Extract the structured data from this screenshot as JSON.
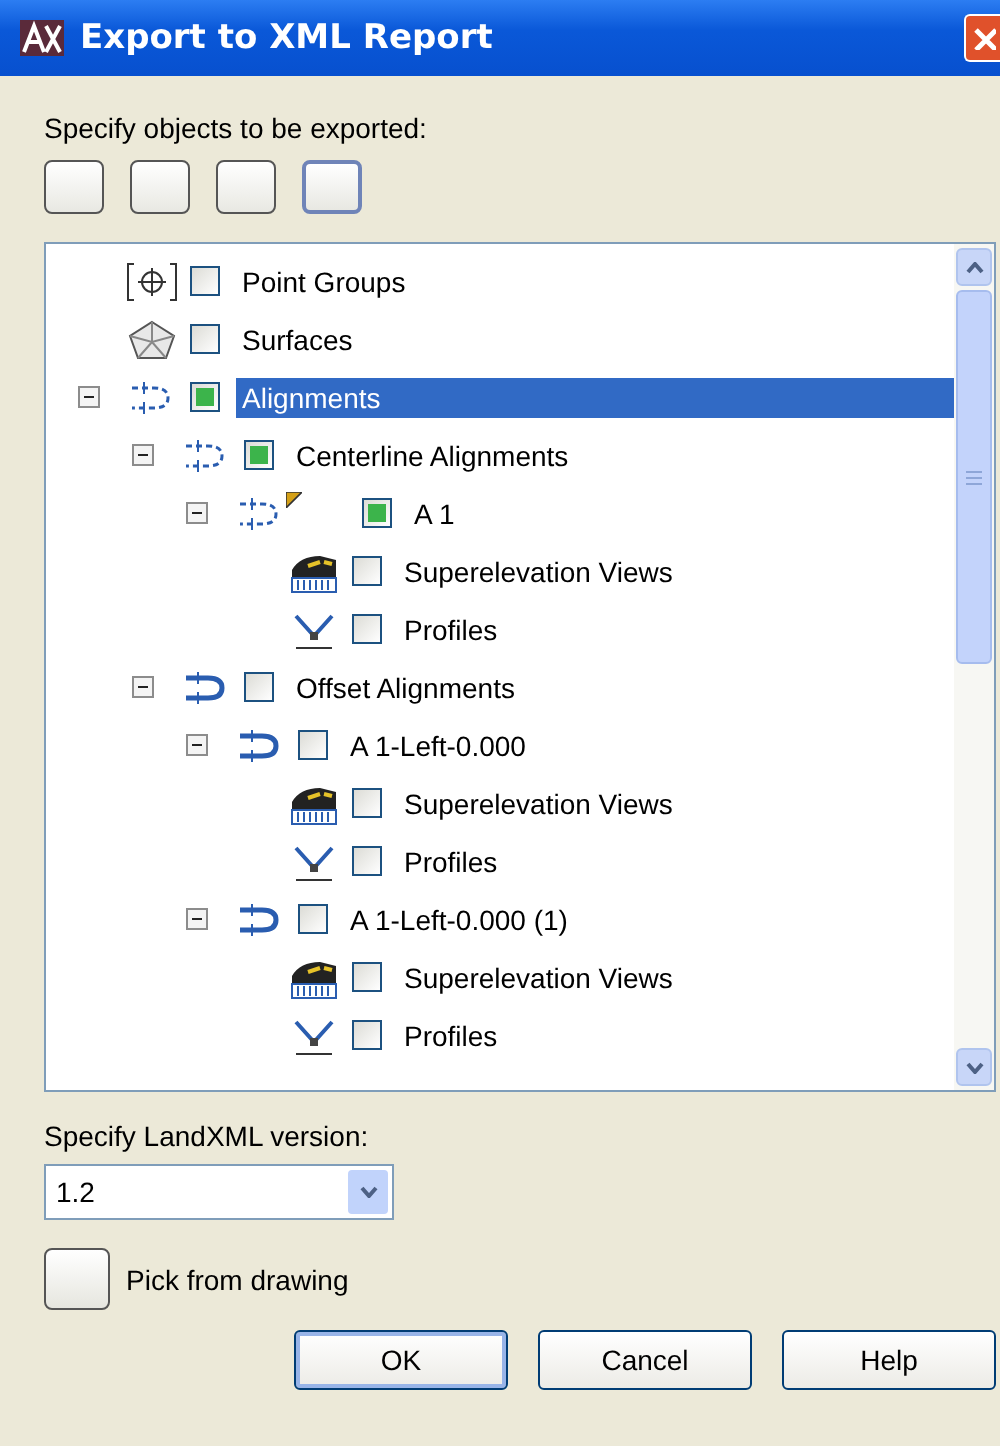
{
  "window": {
    "title": "Export to XML Report"
  },
  "objects_label": "Specify objects to be exported:",
  "toolbar_buttons": [
    {
      "selected": false
    },
    {
      "selected": false
    },
    {
      "selected": false
    },
    {
      "selected": true
    }
  ],
  "tree": [
    {
      "kind": "point-group",
      "label": "Point Groups",
      "checked": false,
      "selected": false
    },
    {
      "kind": "surface",
      "label": "Surfaces",
      "checked": false,
      "selected": false
    },
    {
      "kind": "alignment",
      "label": "Alignments",
      "checked": true,
      "selected": true,
      "expanded": true,
      "children": [
        {
          "kind": "alignment",
          "label": "Centerline Alignments",
          "checked": true,
          "selected": false,
          "expanded": true,
          "children": [
            {
              "kind": "alignment-flagged",
              "label": "A 1",
              "checked": true,
              "selected": false,
              "expanded": true,
              "children": [
                {
                  "kind": "superelevation",
                  "label": "Superelevation Views",
                  "checked": false,
                  "selected": false
                },
                {
                  "kind": "profile",
                  "label": "Profiles",
                  "checked": false,
                  "selected": false
                }
              ]
            }
          ]
        },
        {
          "kind": "offset-alignment",
          "label": "Offset Alignments",
          "checked": false,
          "selected": false,
          "expanded": true,
          "children": [
            {
              "kind": "offset-alignment",
              "label": "A 1-Left-0.000",
              "checked": false,
              "selected": false,
              "expanded": true,
              "children": [
                {
                  "kind": "superelevation",
                  "label": "Superelevation Views",
                  "checked": false,
                  "selected": false
                },
                {
                  "kind": "profile",
                  "label": "Profiles",
                  "checked": false,
                  "selected": false
                }
              ]
            },
            {
              "kind": "offset-alignment",
              "label": "A 1-Left-0.000 (1)",
              "checked": false,
              "selected": false,
              "expanded": true,
              "children": [
                {
                  "kind": "superelevation",
                  "label": "Superelevation Views",
                  "checked": false,
                  "selected": false
                },
                {
                  "kind": "profile",
                  "label": "Profiles",
                  "checked": false,
                  "selected": false
                }
              ]
            }
          ]
        }
      ]
    }
  ],
  "version_label": "Specify LandXML version:",
  "version": {
    "value": "1.2"
  },
  "pick_label": "Pick from drawing",
  "buttons": [
    "OK",
    "Cancel",
    "Help"
  ]
}
